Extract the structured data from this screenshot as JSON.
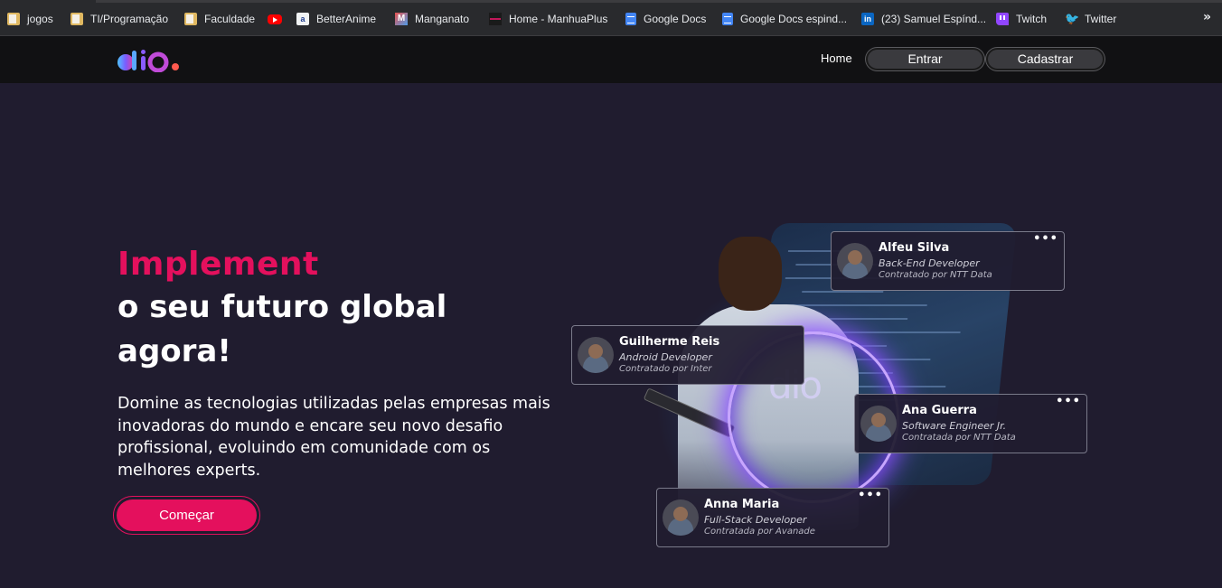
{
  "bookmarks": {
    "items": [
      {
        "label": "jogos",
        "icon": "folder-icon"
      },
      {
        "label": "TI/Programação",
        "icon": "folder-icon"
      },
      {
        "label": "Faculdade",
        "icon": "folder-icon"
      },
      {
        "label": "",
        "icon": "youtube-icon"
      },
      {
        "label": "BetterAnime",
        "icon": "betteranime-icon"
      },
      {
        "label": "Manganato",
        "icon": "manganato-icon"
      },
      {
        "label": "Home - ManhuaPlus",
        "icon": "manhuaplus-icon"
      },
      {
        "label": "Google Docs",
        "icon": "google-docs-icon"
      },
      {
        "label": "Google Docs espind...",
        "icon": "google-docs-icon"
      },
      {
        "label": "(23) Samuel Espínd...",
        "icon": "linkedin-icon"
      },
      {
        "label": "Twitch",
        "icon": "twitch-icon"
      },
      {
        "label": "Twitter",
        "icon": "twitter-icon"
      }
    ],
    "more": "»"
  },
  "nav": {
    "home": "Home",
    "login": "Entrar",
    "signup": "Cadastrar"
  },
  "hero": {
    "accent": "Implement",
    "line2": "o seu futuro global",
    "line3": "agora!",
    "description": "Domine as tecnologias utilizadas pelas empresas mais inovadoras do mundo e encare seu novo desafio profissional, evoluindo em comunidade com os melhores experts.",
    "cta": "Começar"
  },
  "cards": [
    {
      "name": "Alfeu Silva",
      "role": "Back-End Developer",
      "hired": "Contratado por NTT Data"
    },
    {
      "name": "Guilherme Reis",
      "role": "Android Developer",
      "hired": "Contratado por Inter"
    },
    {
      "name": "Ana Guerra",
      "role": "Software Engineer Jr.",
      "hired": "Contratada por NTT Data"
    },
    {
      "name": "Anna Maria",
      "role": "Full-Stack Developer",
      "hired": "Contratada por Avanade"
    }
  ],
  "colors": {
    "accent": "#e4105d",
    "background": "#201c2f",
    "nav_background": "#111113"
  }
}
